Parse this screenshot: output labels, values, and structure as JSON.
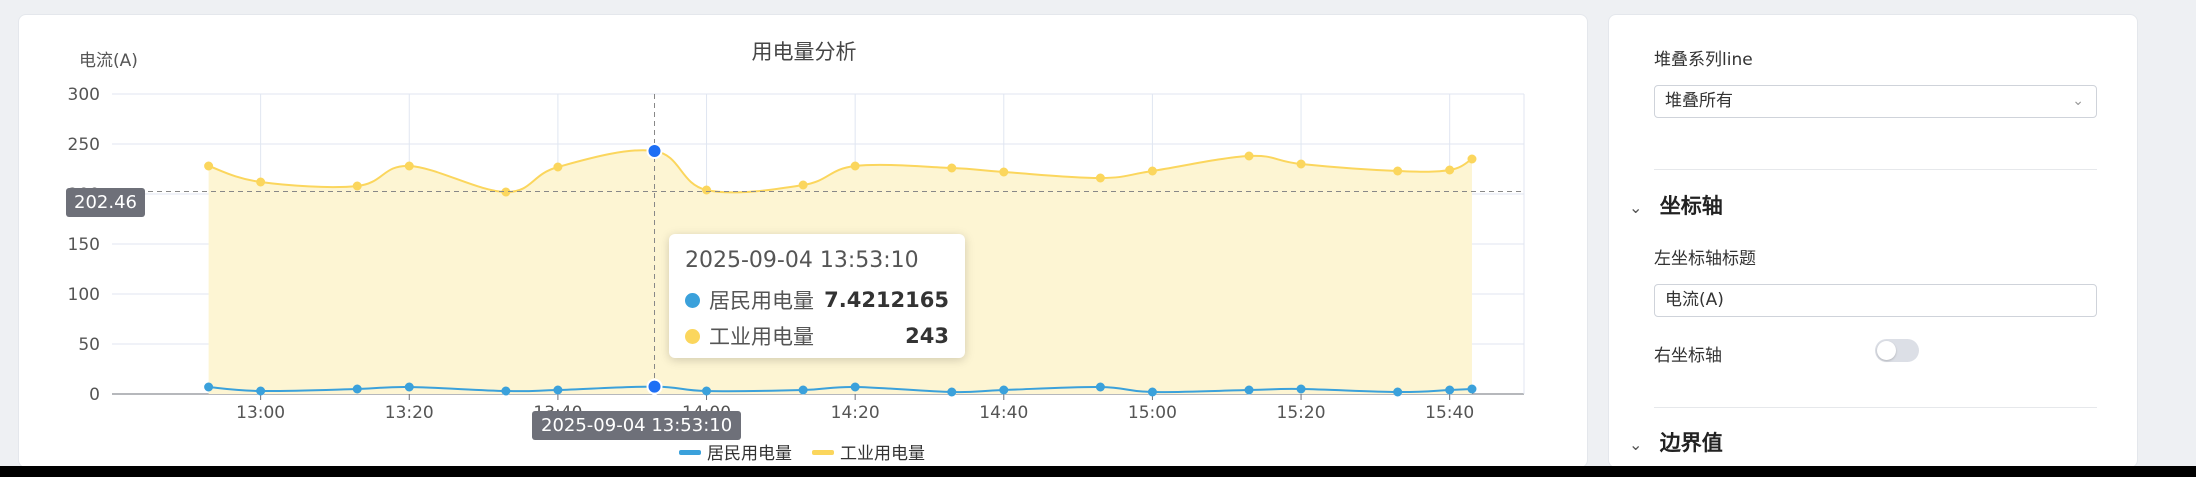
{
  "chart_data": {
    "type": "line",
    "title": "用电量分析",
    "ylabel": "电流(A)",
    "ylim": [
      0,
      300
    ],
    "yticks": [
      0,
      50,
      100,
      150,
      200,
      250,
      300
    ],
    "x_tick_labels": [
      "13:00",
      "13:20",
      "13:40",
      "14:00",
      "14:20",
      "14:40",
      "15:00",
      "15:20",
      "15:40"
    ],
    "x": [
      "12:53",
      "13:00",
      "13:13",
      "13:20",
      "13:33",
      "13:40",
      "13:53",
      "14:00",
      "14:13",
      "14:20",
      "14:33",
      "14:40",
      "14:53",
      "15:00",
      "15:13",
      "15:20",
      "15:33",
      "15:40",
      "15:43"
    ],
    "series": [
      {
        "name": "居民用电量",
        "color": "#3ba1db",
        "values": [
          7,
          3,
          5,
          7,
          3,
          4,
          7.4212165,
          3,
          4,
          7,
          2,
          4,
          7,
          2,
          4,
          5,
          2,
          4,
          5
        ]
      },
      {
        "name": "工业用电量",
        "color": "#fbd65d",
        "area": true,
        "values": [
          228,
          212,
          208,
          228,
          202,
          227,
          243,
          204,
          209,
          228,
          226,
          222,
          216,
          223,
          238,
          230,
          223,
          224,
          235
        ]
      }
    ],
    "grid": true,
    "legend": "bottom-center"
  },
  "tooltip": {
    "time": "2025-09-04 13:53:10",
    "rows": [
      {
        "name": "居民用电量",
        "value": "7.4212165",
        "color": "#3ba1db"
      },
      {
        "name": "工业用电量",
        "value": "243",
        "color": "#fbd65d"
      }
    ]
  },
  "axis_pointer": {
    "x_label": "2025-09-04 13:53:10",
    "y_label": "202.46",
    "y_value": 202.46
  },
  "settings": {
    "stack_label": "堆叠系列line",
    "stack_value": "堆叠所有",
    "axis_section": "坐标轴",
    "left_axis_title_label": "左坐标轴标题",
    "left_axis_title_value": "电流(A)",
    "right_axis_label": "右坐标轴",
    "right_axis_enabled": false,
    "boundary_section": "边界值"
  }
}
